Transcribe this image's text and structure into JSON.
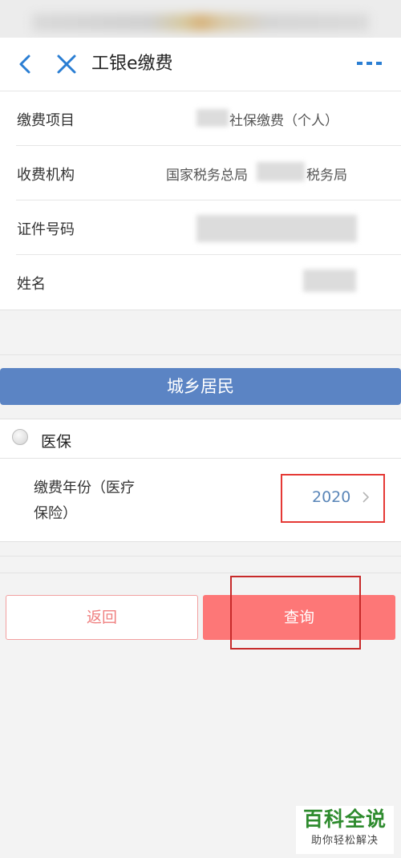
{
  "header": {
    "title": "工银e缴费"
  },
  "info": {
    "rows": [
      {
        "label": "缴费项目",
        "value": "社保缴费（个人）"
      },
      {
        "label": "收费机构",
        "value_prefix": "国家税务总局",
        "value_suffix": "税务局"
      },
      {
        "label": "证件号码",
        "value": ""
      },
      {
        "label": "姓名",
        "value": ""
      }
    ]
  },
  "category": {
    "label": "城乡居民"
  },
  "option": {
    "label": "医保",
    "selected": false
  },
  "year": {
    "label": "缴费年份（医疗保险）",
    "value": "2020"
  },
  "actions": {
    "back_label": "返回",
    "query_label": "查询"
  },
  "watermark": {
    "title": "百科全说",
    "subtitle": "助你轻松解决"
  },
  "colors": {
    "accent_blue": "#5b84c4",
    "query_red": "#fd7777",
    "highlight_red": "#e53935",
    "watermark_green": "#2e8b2e"
  },
  "icons": [
    "chevron-left-icon",
    "close-icon",
    "more-icon",
    "chevron-right-icon"
  ]
}
